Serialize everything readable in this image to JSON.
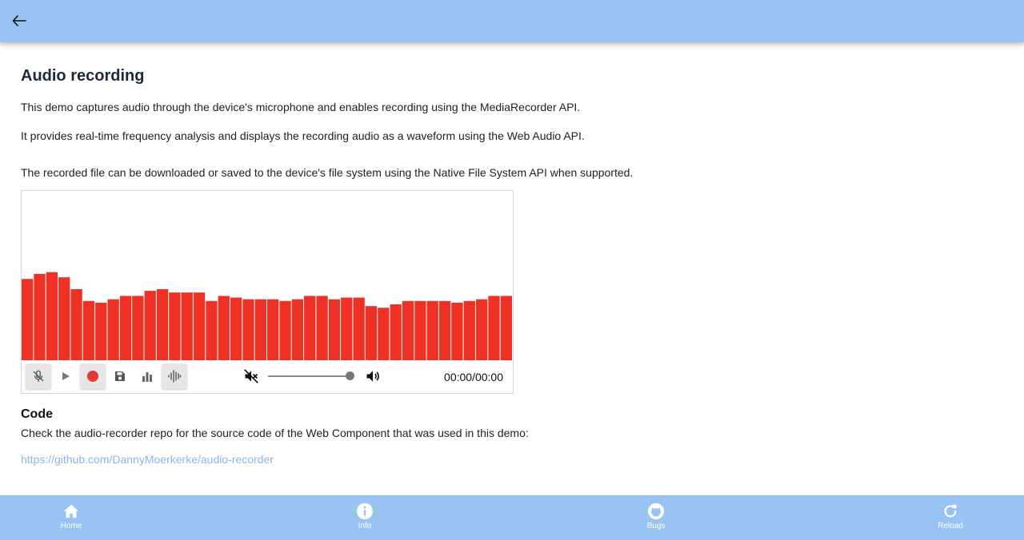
{
  "topbar": {
    "back_icon": "arrow-left-icon"
  },
  "page": {
    "title": "Audio recording",
    "paragraphs": [
      "This demo captures audio through the device's microphone and enables recording using the MediaRecorder API.",
      "It provides real-time frequency analysis and displays the recording audio as a waveform using the Web Audio API.",
      "The recorded file can be downloaded or saved to the device's file system using the Native File System API when supported."
    ]
  },
  "recorder": {
    "bar_color": "#ee3124",
    "frequency_levels": [
      0.48,
      0.51,
      0.52,
      0.49,
      0.42,
      0.35,
      0.34,
      0.36,
      0.38,
      0.38,
      0.41,
      0.42,
      0.4,
      0.4,
      0.4,
      0.35,
      0.38,
      0.37,
      0.36,
      0.36,
      0.36,
      0.35,
      0.36,
      0.38,
      0.38,
      0.36,
      0.37,
      0.37,
      0.32,
      0.31,
      0.33,
      0.35,
      0.35,
      0.35,
      0.35,
      0.34,
      0.35,
      0.36,
      0.38,
      0.38
    ],
    "buttons": {
      "mic": "mic-off-icon",
      "play": "play-icon",
      "record": "record-icon",
      "save": "save-icon",
      "frequency": "bar-chart-icon",
      "waveform": "waveform-icon"
    },
    "mute_icon": "volume-off-icon",
    "volume_icon": "volume-up-icon",
    "volume_level": 0.97,
    "time": "00:00/00:00",
    "record_color": "#e53935"
  },
  "code": {
    "heading": "Code",
    "description": "Check the audio-recorder repo for the source code of the Web Component that was used in this demo:",
    "link": "https://github.com/DannyMoerkerke/audio-recorder"
  },
  "bottom_nav": [
    {
      "label": "Home",
      "icon": "home-icon"
    },
    {
      "label": "Info",
      "icon": "info-icon"
    },
    {
      "label": "Bugs",
      "icon": "github-icon"
    },
    {
      "label": "Reload",
      "icon": "reload-icon"
    }
  ]
}
